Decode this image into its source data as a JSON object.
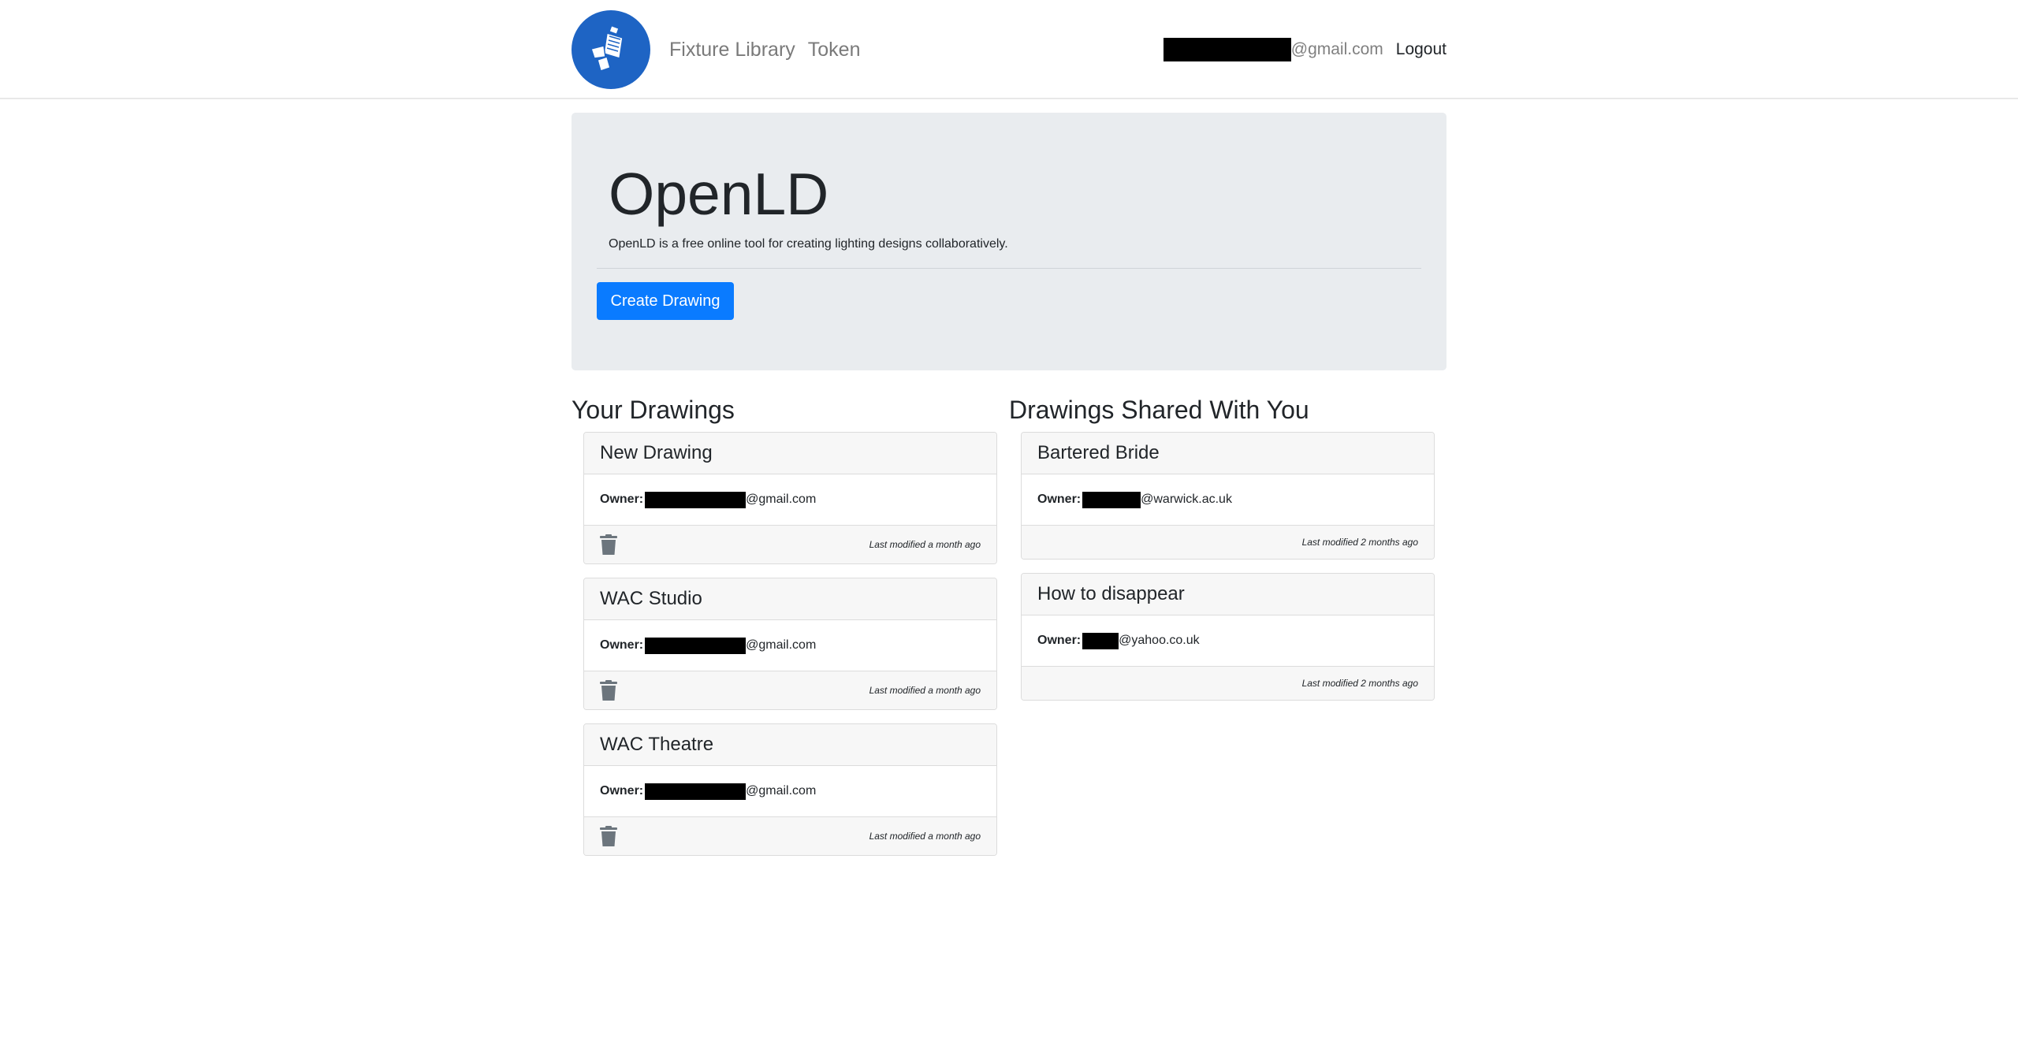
{
  "nav": {
    "links": [
      "Fixture Library",
      "Token"
    ],
    "user_email_suffix": "@gmail.com",
    "logout_label": "Logout"
  },
  "jumbotron": {
    "title": "OpenLD",
    "lead": "OpenLD is a free online tool for creating lighting designs collaboratively.",
    "create_button_label": "Create Drawing"
  },
  "your_drawings": {
    "title": "Your Drawings",
    "owner_label": "Owner:",
    "items": [
      {
        "name": "New Drawing",
        "owner_suffix": "@gmail.com",
        "modified": "Last modified a month ago"
      },
      {
        "name": "WAC Studio",
        "owner_suffix": "@gmail.com",
        "modified": "Last modified a month ago"
      },
      {
        "name": "WAC Theatre",
        "owner_suffix": "@gmail.com",
        "modified": "Last modified a month ago"
      }
    ]
  },
  "shared_drawings": {
    "title": "Drawings Shared With You",
    "owner_label": "Owner:",
    "items": [
      {
        "name": "Bartered Bride",
        "owner_suffix": "@warwick.ac.uk",
        "modified": "Last modified 2 months ago"
      },
      {
        "name": "How to disappear",
        "owner_suffix": "@yahoo.co.uk",
        "modified": "Last modified 2 months ago"
      }
    ]
  },
  "colors": {
    "primary": "#0a7bff",
    "logo": "#1e64c4",
    "jumbotron": "#e9ecef"
  },
  "icons": {
    "logo": "lighting-fixture-logo",
    "delete": "trash-icon"
  }
}
